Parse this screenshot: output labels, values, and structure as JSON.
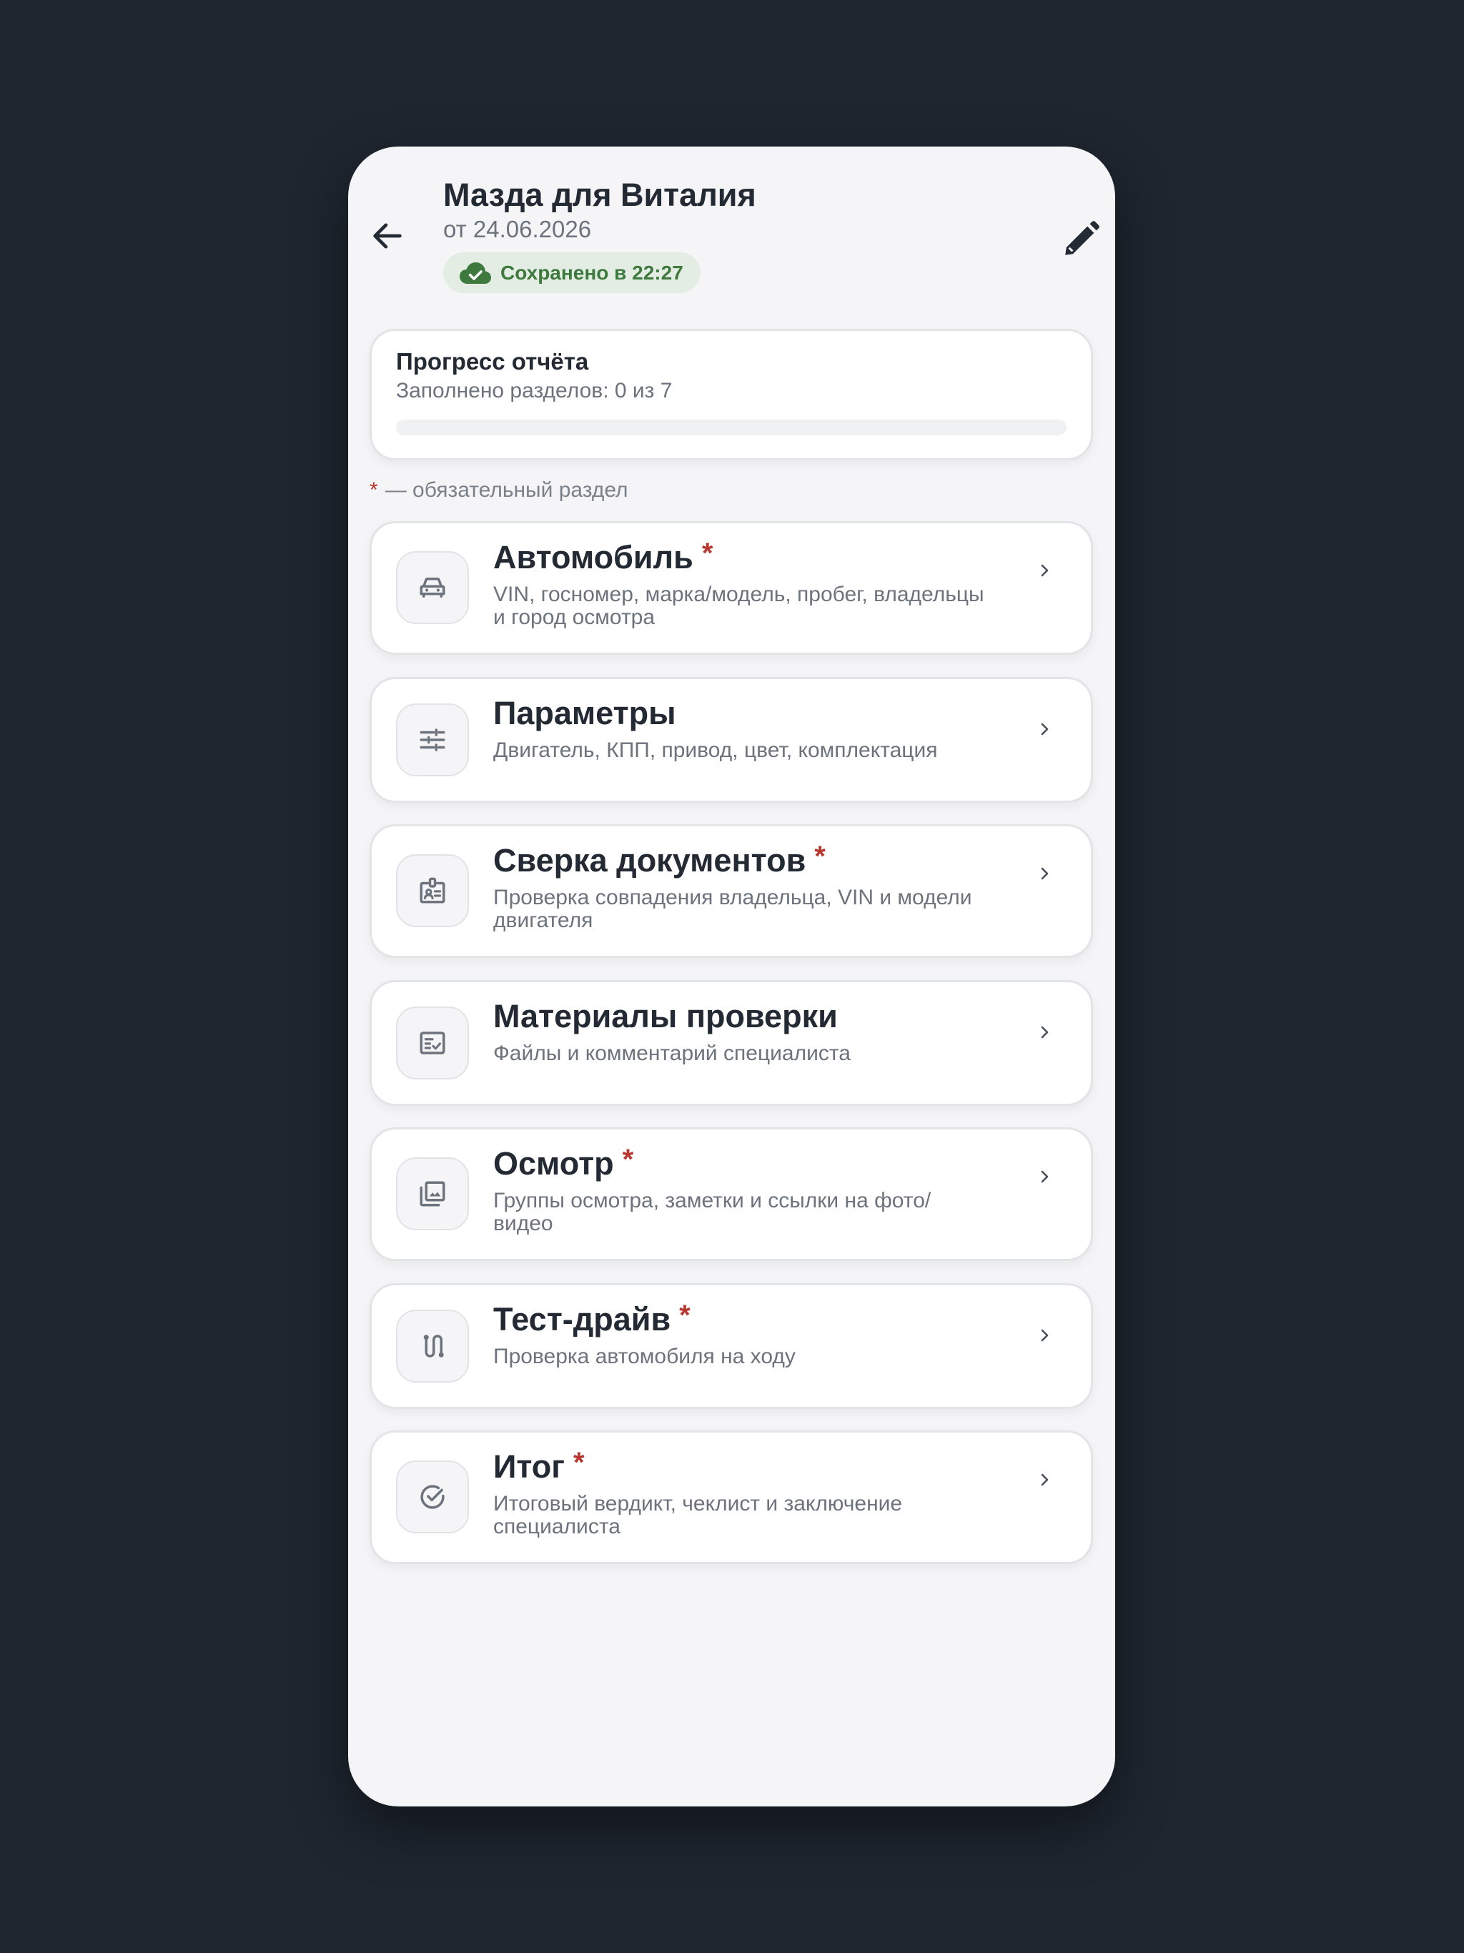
{
  "header": {
    "title": "Мазда для Виталия",
    "date": "от 24.06.2026",
    "saved_status": "Сохранено в 22:27",
    "back_icon": "arrow-left-icon",
    "edit_icon": "pencil-icon"
  },
  "progress": {
    "title": "Прогресс отчёта",
    "subtitle": "Заполнено разделов: 0 из 7",
    "filled": 0,
    "total": 7
  },
  "required_note": {
    "star": "*",
    "text": "— обязательный раздел"
  },
  "sections": [
    {
      "title": "Автомобиль",
      "required": "*",
      "subtitle": "VIN, госномер, марка/модель, пробег, владельцы и город осмотра",
      "icon": "car-icon"
    },
    {
      "title": "Параметры",
      "required": "",
      "subtitle": "Двигатель, КПП, привод, цвет, комплектация",
      "icon": "sliders-icon"
    },
    {
      "title": "Сверка документов",
      "required": "*",
      "subtitle": "Проверка совпадения владельца, VIN и модели двигателя",
      "icon": "id-badge-icon"
    },
    {
      "title": "Материалы проверки",
      "required": "",
      "subtitle": "Файлы и комментарий специалиста",
      "icon": "checklist-icon"
    },
    {
      "title": "Осмотр",
      "required": "*",
      "subtitle": "Группы осмотра, заметки и ссылки на фото/видео",
      "icon": "photo-library-icon"
    },
    {
      "title": "Тест-драйв",
      "required": "*",
      "subtitle": "Проверка автомобиля на ходу",
      "icon": "route-icon"
    },
    {
      "title": "Итог",
      "required": "*",
      "subtitle": "Итоговый вердикт, чеклист и заключение специалиста",
      "icon": "check-circle-icon"
    }
  ],
  "colors": {
    "background": "#1f2630",
    "screen": "#f5f5f7",
    "required_star": "#b7372f",
    "saved_green": "#3e7a3e",
    "saved_bg": "#e4ede4"
  }
}
